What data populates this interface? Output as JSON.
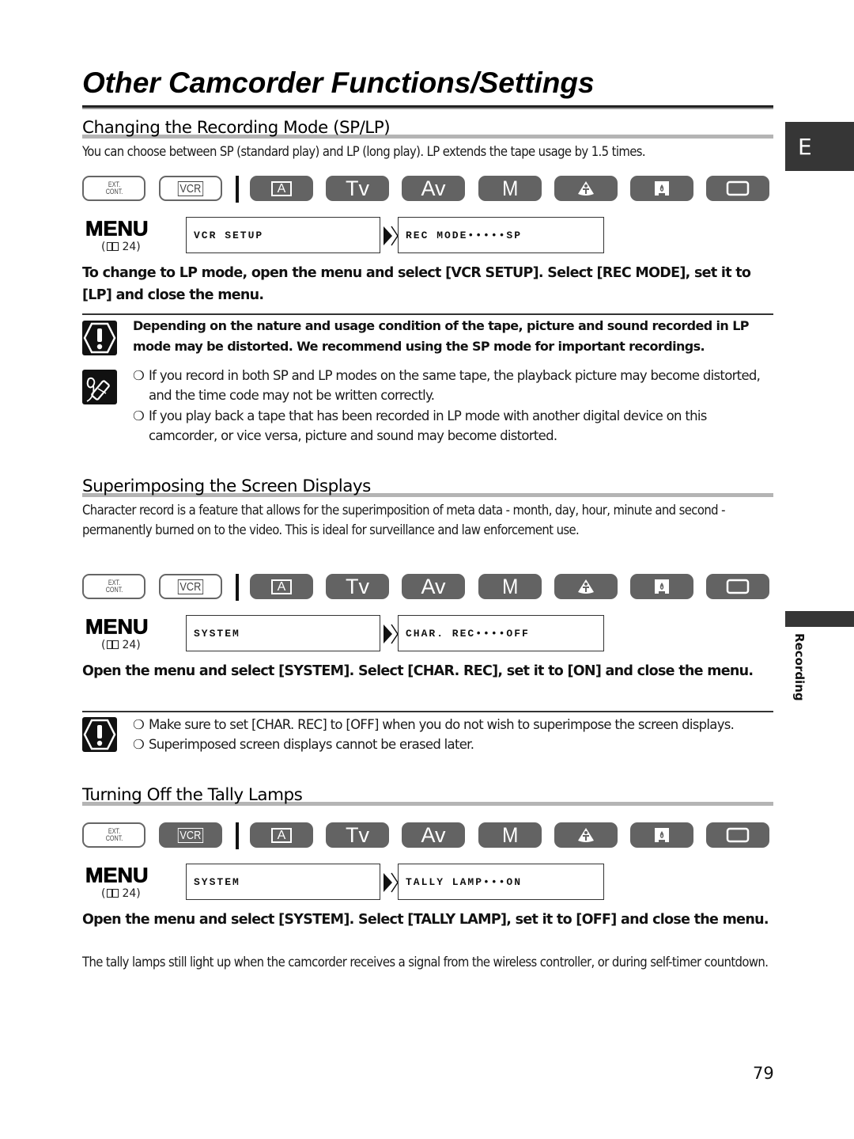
{
  "page": {
    "title": "Other Camcorder Functions/Settings",
    "language_tab": "E",
    "chapter_label": "Recording",
    "page_number": "79"
  },
  "mode_buttons": {
    "ext_cont_line1": "EXT.",
    "ext_cont_line2": "CONT.",
    "vcr": "VCR",
    "auto": "A",
    "tv": "Tv",
    "av": "Av",
    "manual": "M",
    "icons": [
      "easy-recording-icon",
      "night-mode-icon",
      "card-camera-icon"
    ]
  },
  "menu_common": {
    "label": "MENU",
    "ref_open": "(",
    "ref_page": "24)"
  },
  "sections": [
    {
      "heading": "Changing the Recording Mode (SP/LP)",
      "intro": "You can choose between SP (standard play) and LP (long play). LP extends the tape usage by 1.5 times.",
      "active_modes": [
        "A",
        "Tv",
        "Av",
        "M",
        "easy",
        "night",
        "card"
      ],
      "menu_path": [
        "VCR SETUP",
        "REC MODE•••••SP"
      ],
      "instruction": "To change to LP mode, open the menu and select [VCR SETUP]. Select [REC MODE], set it to [LP] and close the menu.",
      "caution": "Depending on the nature and usage condition of the tape, picture and sound recorded in LP mode may be distorted. We recommend using the SP mode for important recordings.",
      "notes": [
        "If you record in both SP and LP modes on the same tape, the playback picture may become distorted, and the time code may not be written correctly.",
        "If you play back a tape that has been recorded in LP mode with another digital device on this camcorder, or vice versa, picture and sound may become distorted."
      ]
    },
    {
      "heading": "Superimposing the Screen Displays",
      "intro": "Character record is a feature that allows for the superimposition of meta data - month, day, hour, minute and second - permanently burned on to the video. This is ideal for surveillance and law enforcement use.",
      "active_modes": [
        "A",
        "Tv",
        "Av",
        "M",
        "easy",
        "night",
        "card"
      ],
      "menu_path": [
        "SYSTEM",
        "CHAR. REC••••OFF"
      ],
      "instruction": "Open the menu and select [SYSTEM]. Select [CHAR. REC], set it to [ON] and close the menu.",
      "cautions": [
        "Make sure to set [CHAR. REC] to [OFF] when you do not wish to superimpose the screen displays.",
        "Superimposed screen displays cannot be erased later."
      ]
    },
    {
      "heading": "Turning Off the Tally Lamps",
      "active_modes": [
        "VCR",
        "A",
        "Tv",
        "Av",
        "M",
        "easy",
        "night",
        "card"
      ],
      "menu_path": [
        "SYSTEM",
        "TALLY LAMP•••ON"
      ],
      "instruction": "Open the menu and select [SYSTEM]. Select [TALLY LAMP], set it to [OFF] and close the menu.",
      "note": "The tally lamps still light up when the camcorder receives a signal from the wireless controller, or during self-timer countdown."
    }
  ],
  "bullet_glyph": "❍"
}
